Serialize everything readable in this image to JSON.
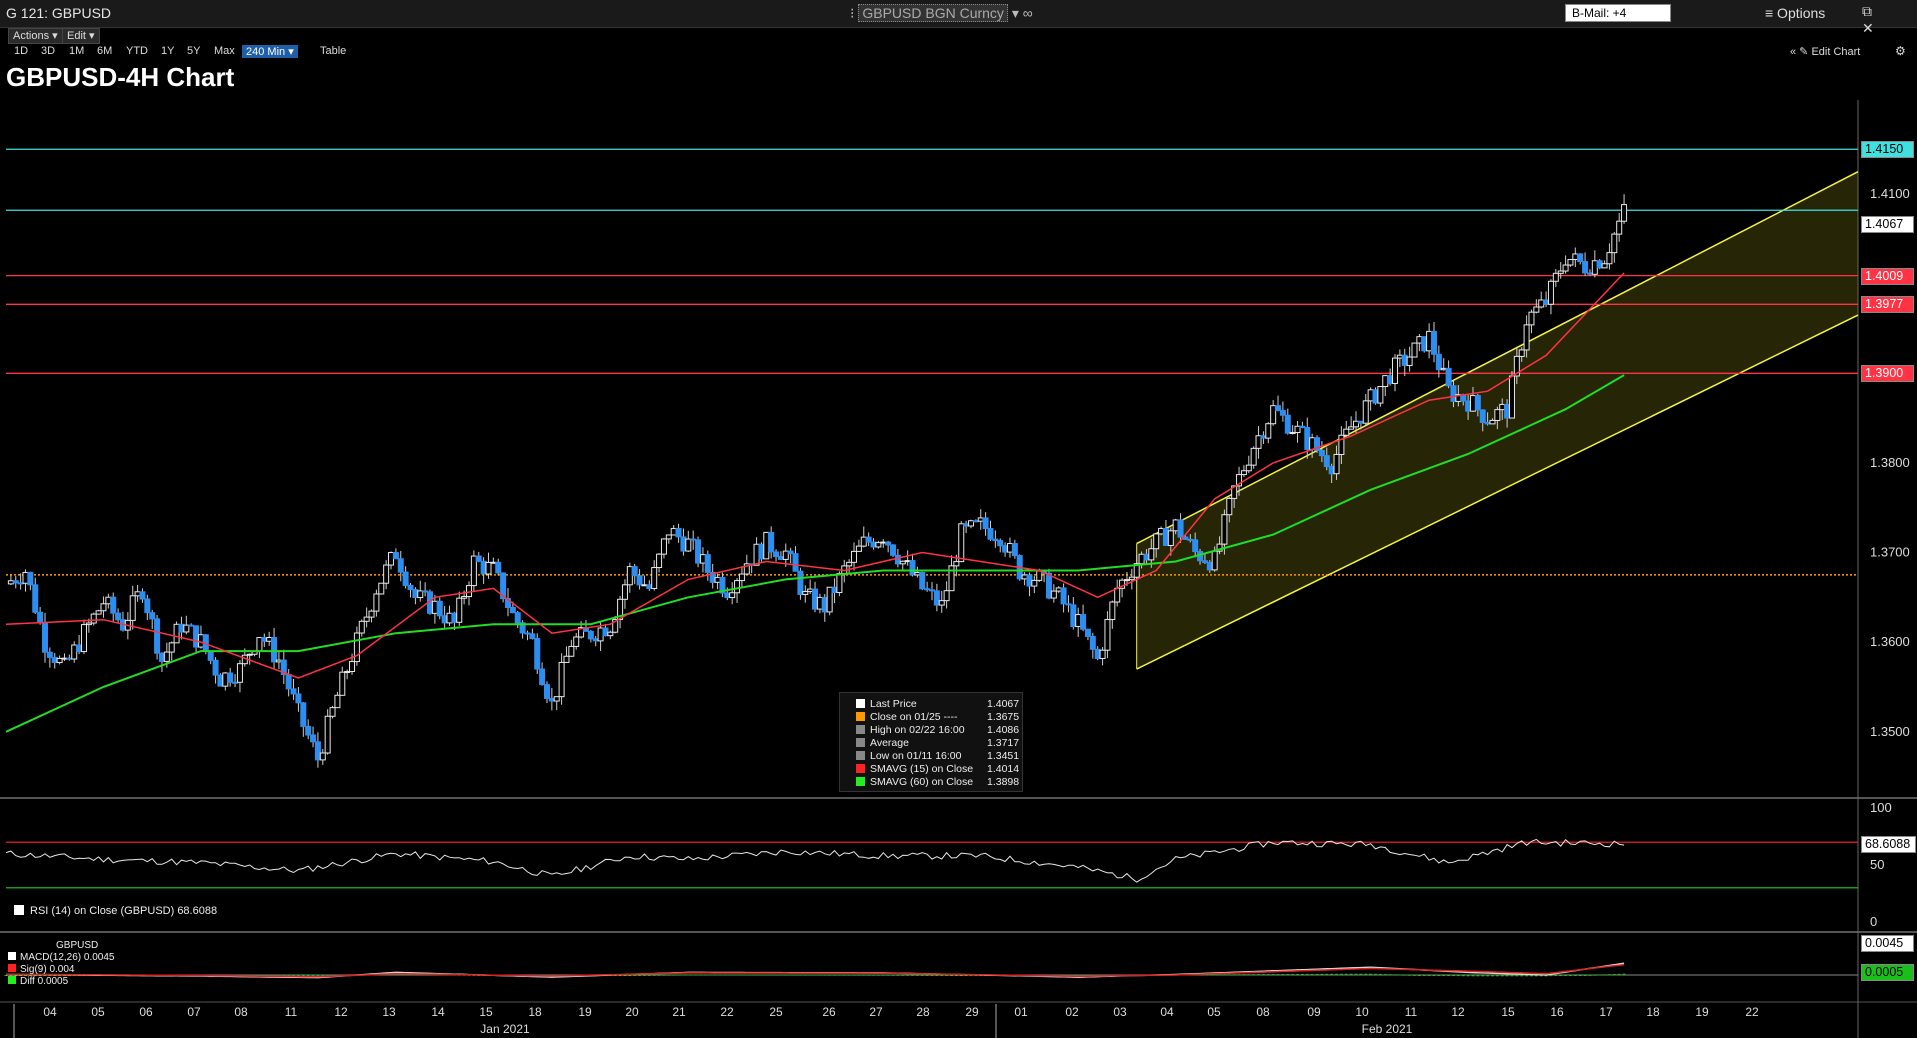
{
  "window": {
    "title": "G 121: GBPUSD",
    "ticker_field": "GBPUSD BGN Curncy",
    "ticker_arrow": "▾",
    "link_icon": "∞",
    "bmail": "B-Mail: +4",
    "options_label": "≡ Options",
    "window_buttons": "⧉ ✕"
  },
  "menu": {
    "actions": "Actions ▾",
    "edit": "Edit ▾"
  },
  "ranges": [
    "1D",
    "3D",
    "1M",
    "6M",
    "YTD",
    "1Y",
    "5Y",
    "Max"
  ],
  "selected_range": "240 Min ▾",
  "table_label": "Table",
  "edit_chart": "« ✎ Edit Chart",
  "chart_title": "GBPUSD-4H Chart",
  "price_labels": {
    "resistance_1": "1.4150",
    "last": "1.4067",
    "support_1": "1.4009",
    "support_2": "1.3977",
    "support_3": "1.3900"
  },
  "price_axis": [
    "1.4100",
    "1.3800",
    "1.3700",
    "1.3600",
    "1.3500"
  ],
  "legend": [
    {
      "label": "Last Price",
      "value": "1.4067",
      "color": "#ffffff"
    },
    {
      "label": "Close on 01/25 ----",
      "value": "1.3675",
      "color": "#ff9900"
    },
    {
      "label": "High on 02/22 16:00",
      "value": "1.4086",
      "color": "#888888"
    },
    {
      "label": "Average",
      "value": "1.3717",
      "color": "#888888"
    },
    {
      "label": "Low on 01/11 16:00",
      "value": "1.3451",
      "color": "#888888"
    },
    {
      "label": "SMAVG (15)  on Close",
      "value": "1.4014",
      "color": "#ff2222"
    },
    {
      "label": "SMAVG (60)  on Close",
      "value": "1.3898",
      "color": "#22ee22"
    }
  ],
  "rsi": {
    "legend": "RSI (14)  on Close (GBPUSD)  68.6088",
    "value_label": "68.6088",
    "axis": [
      "100",
      "50",
      "0"
    ]
  },
  "macd": {
    "title": "GBPUSD",
    "rows": [
      {
        "label": "MACD(12,26)",
        "value": "0.0045",
        "color": "#ffffff"
      },
      {
        "label": "Sig(9)",
        "value": "0.004",
        "color": "#ff2222"
      },
      {
        "label": "Diff",
        "value": "0.0005",
        "color": "#22ee22"
      }
    ],
    "macd_label": "0.0045",
    "diff_label": "0.0005"
  },
  "x_axis": {
    "days": [
      "04",
      "05",
      "06",
      "07",
      "08",
      "11",
      "12",
      "13",
      "14",
      "15",
      "18",
      "19",
      "20",
      "21",
      "22",
      "25",
      "26",
      "27",
      "28",
      "29",
      "01",
      "02",
      "03",
      "04",
      "05",
      "08",
      "09",
      "10",
      "11",
      "12",
      "15",
      "16",
      "17",
      "18",
      "19",
      "22"
    ],
    "months": [
      "Jan 2021",
      "Feb 2021"
    ]
  },
  "chart_data": {
    "type": "candlestick",
    "series": "GBPUSD 4H",
    "ylim": [
      1.3435,
      1.4205
    ],
    "horizontal_levels": [
      {
        "value": 1.415,
        "color": "#40e0e0"
      },
      {
        "value": 1.4082,
        "color": "#40e0e0"
      },
      {
        "value": 1.4009,
        "color": "#ff3344"
      },
      {
        "value": 1.3977,
        "color": "#ff3344"
      },
      {
        "value": 1.39,
        "color": "#ff3344"
      },
      {
        "value": 1.3675,
        "color": "#ff9900"
      }
    ],
    "close_path": [
      [
        0,
        1.3665
      ],
      [
        2,
        1.368
      ],
      [
        4,
        1.36
      ],
      [
        6,
        1.357
      ],
      [
        8,
        1.361
      ],
      [
        10,
        1.3645
      ],
      [
        12,
        1.362
      ],
      [
        14,
        1.366
      ],
      [
        16,
        1.358
      ],
      [
        18,
        1.362
      ],
      [
        20,
        1.36
      ],
      [
        22,
        1.356
      ],
      [
        24,
        1.357
      ],
      [
        26,
        1.361
      ],
      [
        28,
        1.358
      ],
      [
        30,
        1.352
      ],
      [
        32,
        1.347
      ],
      [
        34,
        1.354
      ],
      [
        36,
        1.36
      ],
      [
        38,
        1.366
      ],
      [
        40,
        1.37
      ],
      [
        42,
        1.365
      ],
      [
        44,
        1.364
      ],
      [
        46,
        1.362
      ],
      [
        48,
        1.369
      ],
      [
        50,
        1.368
      ],
      [
        52,
        1.363
      ],
      [
        54,
        1.36
      ],
      [
        56,
        1.353
      ],
      [
        58,
        1.36
      ],
      [
        60,
        1.361
      ],
      [
        62,
        1.362
      ],
      [
        64,
        1.368
      ],
      [
        66,
        1.366
      ],
      [
        68,
        1.3725
      ],
      [
        70,
        1.371
      ],
      [
        72,
        1.368
      ],
      [
        74,
        1.366
      ],
      [
        76,
        1.369
      ],
      [
        78,
        1.371
      ],
      [
        80,
        1.37
      ],
      [
        82,
        1.365
      ],
      [
        84,
        1.364
      ],
      [
        86,
        1.368
      ],
      [
        88,
        1.371
      ],
      [
        90,
        1.372
      ],
      [
        92,
        1.369
      ],
      [
        94,
        1.366
      ],
      [
        96,
        1.364
      ],
      [
        98,
        1.372
      ],
      [
        100,
        1.373
      ],
      [
        102,
        1.372
      ],
      [
        104,
        1.368
      ],
      [
        106,
        1.367
      ],
      [
        108,
        1.365
      ],
      [
        110,
        1.362
      ],
      [
        112,
        1.358
      ],
      [
        114,
        1.366
      ],
      [
        116,
        1.369
      ],
      [
        118,
        1.371
      ],
      [
        120,
        1.373
      ],
      [
        122,
        1.37
      ],
      [
        124,
        1.369
      ],
      [
        126,
        1.377
      ],
      [
        128,
        1.382
      ],
      [
        130,
        1.386
      ],
      [
        132,
        1.384
      ],
      [
        134,
        1.382
      ],
      [
        136,
        1.38
      ],
      [
        138,
        1.384
      ],
      [
        140,
        1.387
      ],
      [
        142,
        1.39
      ],
      [
        144,
        1.392
      ],
      [
        146,
        1.394
      ],
      [
        148,
        1.388
      ],
      [
        150,
        1.387
      ],
      [
        152,
        1.385
      ],
      [
        154,
        1.386
      ],
      [
        156,
        1.396
      ],
      [
        158,
        1.398
      ],
      [
        160,
        1.403
      ],
      [
        162,
        1.402
      ],
      [
        164,
        1.403
      ],
      [
        166,
        1.408
      ]
    ],
    "sma15_path": [
      [
        0,
        1.362
      ],
      [
        10,
        1.3625
      ],
      [
        20,
        1.36
      ],
      [
        30,
        1.356
      ],
      [
        36,
        1.3585
      ],
      [
        44,
        1.365
      ],
      [
        50,
        1.366
      ],
      [
        56,
        1.361
      ],
      [
        62,
        1.362
      ],
      [
        70,
        1.367
      ],
      [
        78,
        1.369
      ],
      [
        86,
        1.368
      ],
      [
        94,
        1.37
      ],
      [
        100,
        1.369
      ],
      [
        106,
        1.368
      ],
      [
        112,
        1.365
      ],
      [
        118,
        1.368
      ],
      [
        124,
        1.376
      ],
      [
        130,
        1.38
      ],
      [
        138,
        1.383
      ],
      [
        146,
        1.387
      ],
      [
        152,
        1.388
      ],
      [
        158,
        1.392
      ],
      [
        166,
        1.4012
      ]
    ],
    "sma60_path": [
      [
        0,
        1.35
      ],
      [
        10,
        1.355
      ],
      [
        20,
        1.359
      ],
      [
        30,
        1.359
      ],
      [
        40,
        1.361
      ],
      [
        50,
        1.362
      ],
      [
        60,
        1.362
      ],
      [
        70,
        1.365
      ],
      [
        80,
        1.367
      ],
      [
        90,
        1.368
      ],
      [
        100,
        1.368
      ],
      [
        110,
        1.368
      ],
      [
        120,
        1.369
      ],
      [
        130,
        1.372
      ],
      [
        140,
        1.377
      ],
      [
        150,
        1.381
      ],
      [
        160,
        1.386
      ],
      [
        166,
        1.3898
      ]
    ],
    "channel": {
      "upper": [
        [
          116,
          1.371
        ],
        [
          190,
          1.4125
        ]
      ],
      "lower": [
        [
          116,
          1.357
        ],
        [
          190,
          1.3965
        ]
      ]
    },
    "rsi_path": [
      [
        0,
        60
      ],
      [
        10,
        55
      ],
      [
        20,
        52
      ],
      [
        30,
        45
      ],
      [
        40,
        60
      ],
      [
        50,
        53
      ],
      [
        56,
        40
      ],
      [
        64,
        58
      ],
      [
        70,
        55
      ],
      [
        80,
        62
      ],
      [
        90,
        58
      ],
      [
        100,
        58
      ],
      [
        110,
        48
      ],
      [
        116,
        38
      ],
      [
        120,
        55
      ],
      [
        130,
        70
      ],
      [
        140,
        68
      ],
      [
        148,
        52
      ],
      [
        156,
        70
      ],
      [
        166,
        68.6
      ]
    ],
    "rsi_levels": [
      70,
      30
    ],
    "macd_path": [
      [
        0,
        0.0002
      ],
      [
        20,
        -0.0004
      ],
      [
        32,
        -0.001
      ],
      [
        40,
        0.001
      ],
      [
        56,
        -0.0008
      ],
      [
        70,
        0.001
      ],
      [
        90,
        0.0008
      ],
      [
        110,
        -0.0008
      ],
      [
        120,
        0.0002
      ],
      [
        140,
        0.003
      ],
      [
        150,
        0.001
      ],
      [
        158,
        0.0
      ],
      [
        166,
        0.0045
      ]
    ],
    "signal_path": [
      [
        0,
        0.0003
      ],
      [
        20,
        -0.0002
      ],
      [
        32,
        -0.0007
      ],
      [
        40,
        0.0005
      ],
      [
        56,
        -0.0004
      ],
      [
        70,
        0.0008
      ],
      [
        90,
        0.0007
      ],
      [
        110,
        -0.0005
      ],
      [
        120,
        0.0
      ],
      [
        140,
        0.0025
      ],
      [
        150,
        0.0015
      ],
      [
        158,
        0.0005
      ],
      [
        166,
        0.004
      ]
    ]
  }
}
